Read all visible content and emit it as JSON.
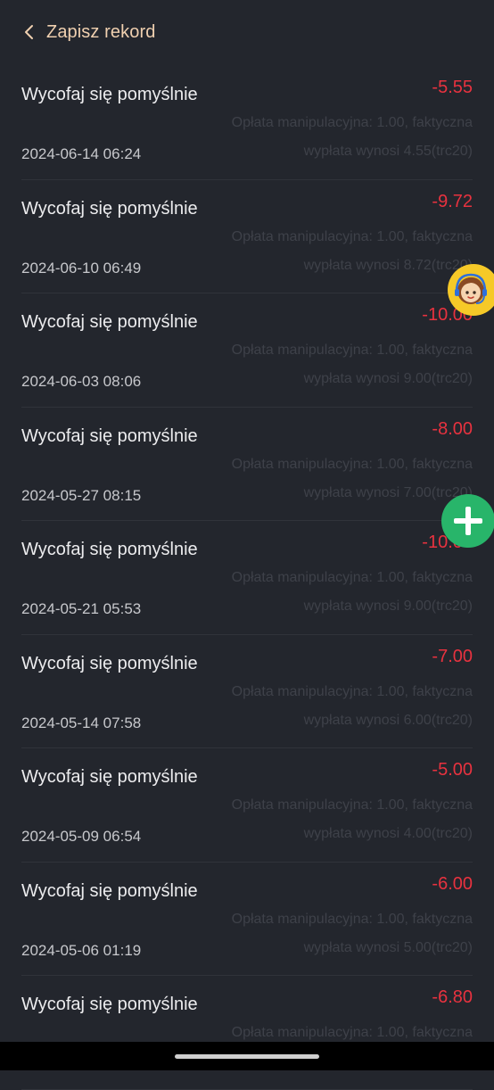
{
  "header": {
    "title": "Zapisz rekord"
  },
  "records": [
    {
      "status": "Wycofaj się pomyślnie",
      "date": "2024-06-14 06:24",
      "amount": "-5.55",
      "detail": "Opłata manipulacyjna: 1.00, faktyczna wypłata wynosi 4.55(trc20)"
    },
    {
      "status": "Wycofaj się pomyślnie",
      "date": "2024-06-10 06:49",
      "amount": "-9.72",
      "detail": "Opłata manipulacyjna: 1.00, faktyczna wypłata wynosi 8.72(trc20)"
    },
    {
      "status": "Wycofaj się pomyślnie",
      "date": "2024-06-03 08:06",
      "amount": "-10.00",
      "detail": "Opłata manipulacyjna: 1.00, faktyczna wypłata wynosi 9.00(trc20)"
    },
    {
      "status": "Wycofaj się pomyślnie",
      "date": "2024-05-27 08:15",
      "amount": "-8.00",
      "detail": "Opłata manipulacyjna: 1.00, faktyczna wypłata wynosi 7.00(trc20)"
    },
    {
      "status": "Wycofaj się pomyślnie",
      "date": "2024-05-21 05:53",
      "amount": "-10.00",
      "detail": "Opłata manipulacyjna: 1.00, faktyczna wypłata wynosi 9.00(trc20)"
    },
    {
      "status": "Wycofaj się pomyślnie",
      "date": "2024-05-14 07:58",
      "amount": "-7.00",
      "detail": "Opłata manipulacyjna: 1.00, faktyczna wypłata wynosi 6.00(trc20)"
    },
    {
      "status": "Wycofaj się pomyślnie",
      "date": "2024-05-09 06:54",
      "amount": "-5.00",
      "detail": "Opłata manipulacyjna: 1.00, faktyczna wypłata wynosi 4.00(trc20)"
    },
    {
      "status": "Wycofaj się pomyślnie",
      "date": "2024-05-06 01:19",
      "amount": "-6.00",
      "detail": "Opłata manipulacyjna: 1.00, faktyczna wypłata wynosi 5.00(trc20)"
    },
    {
      "status": "Wycofaj się pomyślnie",
      "date": "",
      "amount": "-6.80",
      "detail": "Opłata manipulacyjna: 1.00, faktyczna"
    }
  ],
  "icons": {
    "back": "chevron-left-icon",
    "support": "customer-support-icon",
    "add": "plus-icon"
  },
  "colors": {
    "background": "#23262d",
    "title": "#f0d0b0",
    "amount": "#e8323f",
    "support_fab": "#f6c928",
    "add_fab": "#28b56a"
  }
}
